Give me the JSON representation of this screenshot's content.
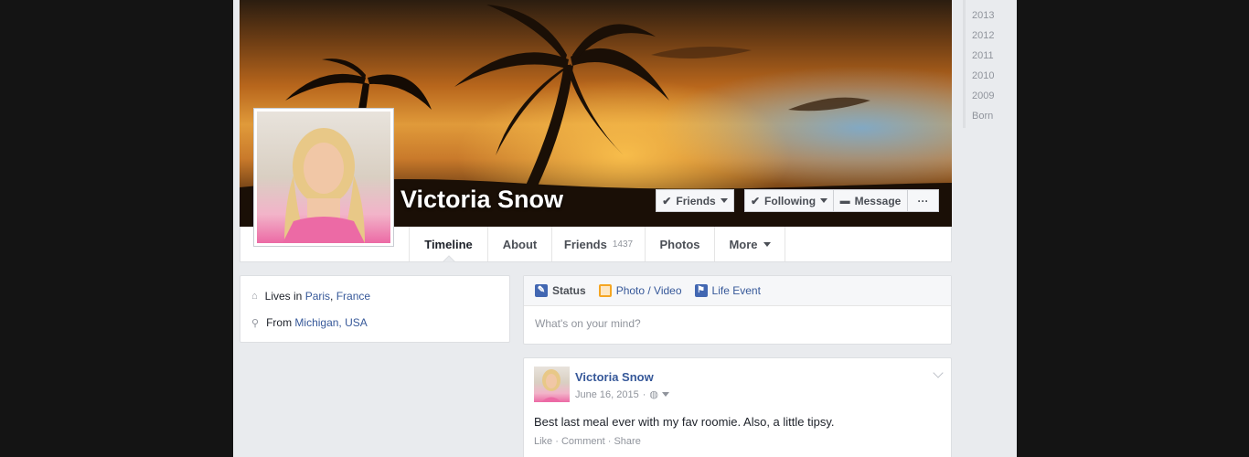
{
  "profile": {
    "name": "Victoria Snow"
  },
  "cover_actions": {
    "friends_label": "Friends",
    "following_label": "Following",
    "message_label": "Message",
    "more_label": "···"
  },
  "nav": {
    "tabs": [
      {
        "label": "Timeline"
      },
      {
        "label": "About"
      },
      {
        "label": "Friends",
        "count": "1437"
      },
      {
        "label": "Photos"
      },
      {
        "label": "More"
      }
    ]
  },
  "intro": {
    "lives_prefix": "Lives in",
    "lives_city": "Paris",
    "lives_sep": ",",
    "lives_country": "France",
    "from_prefix": "From",
    "from_place": "Michigan, USA"
  },
  "composer": {
    "status_label": "Status",
    "photo_label": "Photo / Video",
    "life_event_label": "Life Event",
    "placeholder": "What's on your mind?"
  },
  "post": {
    "author": "Victoria Snow",
    "date": "June 16, 2015",
    "separator": "·",
    "text": "Best last meal ever with my fav roomie. Also, a little tipsy.",
    "like_label": "Like",
    "comment_label": "Comment",
    "share_label": "Share",
    "dot": "·"
  },
  "timeline_years": [
    "2013",
    "2012",
    "2011",
    "2010",
    "2009",
    "Born"
  ],
  "colors": {
    "link": "#365899",
    "background": "#e9ebee",
    "status_icon": "#4267b2",
    "photo_icon": "#f5a623",
    "life_event_icon": "#4267b2"
  },
  "icons": {
    "lives": "house-icon",
    "from": "location-pin-icon",
    "status": "pencil-icon",
    "photo": "photo-icon",
    "life_event": "flag-icon",
    "privacy": "globe-icon"
  }
}
